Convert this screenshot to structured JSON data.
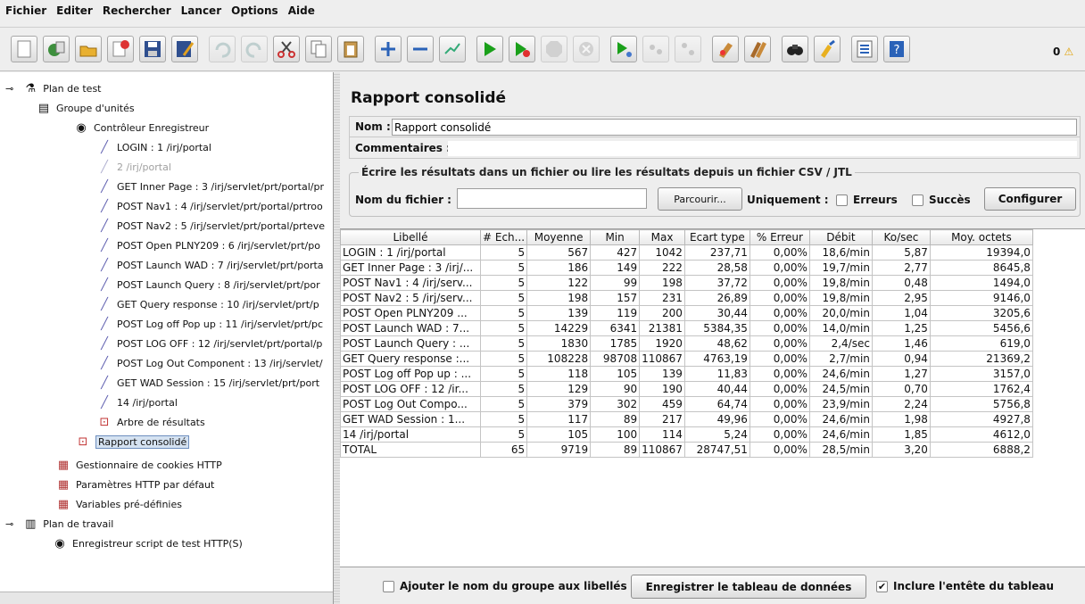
{
  "menu": {
    "items": [
      "Fichier",
      "Editer",
      "Rechercher",
      "Lancer",
      "Options",
      "Aide"
    ]
  },
  "toolbar": {
    "buttons": [
      "new-icon",
      "templates-icon",
      "open-icon",
      "close-icon",
      "save-icon",
      "save-as-icon",
      "undo-icon",
      "redo-icon",
      "cut-icon",
      "copy-icon",
      "paste-icon",
      "expand-icon",
      "collapse-icon",
      "toggle-icon",
      "start-icon",
      "start-no-pause-icon",
      "stop-icon",
      "shutdown-icon",
      "remote-start-icon",
      "remote-stop-icon",
      "remote-shutdown-icon",
      "clear-icon",
      "clear-all-icon",
      "search-icon",
      "reset-search-icon",
      "function-helper-icon",
      "help-icon"
    ],
    "error_count": "0"
  },
  "tree": {
    "nodes": [
      {
        "label": "Plan de test",
        "icon": "beaker-icon"
      },
      {
        "label": "Groupe d'unités",
        "icon": "thread-group-icon"
      },
      {
        "label": "Contrôleur Enregistreur",
        "icon": "controller-icon"
      },
      {
        "label": "LOGIN : 1 /irj/portal",
        "icon": "sampler-icon"
      },
      {
        "label": "2 /irj/portal",
        "icon": "sampler-icon"
      },
      {
        "label": "GET Inner Page : 3 /irj/servlet/prt/portal/pr",
        "icon": "sampler-icon"
      },
      {
        "label": "POST Nav1 : 4 /irj/servlet/prt/portal/prtroo",
        "icon": "sampler-icon"
      },
      {
        "label": "POST Nav2 : 5 /irj/servlet/prt/portal/prteve",
        "icon": "sampler-icon"
      },
      {
        "label": "POST Open PLNY209 : 6 /irj/servlet/prt/po",
        "icon": "sampler-icon"
      },
      {
        "label": "POST Launch WAD : 7 /irj/servlet/prt/porta",
        "icon": "sampler-icon"
      },
      {
        "label": "POST Launch Query : 8 /irj/servlet/prt/por",
        "icon": "sampler-icon"
      },
      {
        "label": "GET Query response : 10 /irj/servlet/prt/p",
        "icon": "sampler-icon"
      },
      {
        "label": "POST Log off Pop up : 11 /irj/servlet/prt/pc",
        "icon": "sampler-icon"
      },
      {
        "label": "POST LOG OFF : 12 /irj/servlet/prt/portal/p",
        "icon": "sampler-icon"
      },
      {
        "label": "POST Log Out Component : 13 /irj/servlet/",
        "icon": "sampler-icon"
      },
      {
        "label": "GET WAD Session : 15 /irj/servlet/prt/port",
        "icon": "sampler-icon"
      },
      {
        "label": "14 /irj/portal",
        "icon": "sampler-icon"
      },
      {
        "label": "Arbre de résultats",
        "icon": "listener-icon"
      },
      {
        "label": "Rapport consolidé",
        "icon": "listener-icon"
      },
      {
        "label": "Gestionnaire de cookies HTTP",
        "icon": "config-icon"
      },
      {
        "label": "Paramètres HTTP par défaut",
        "icon": "config-icon"
      },
      {
        "label": "Variables pré-définies",
        "icon": "config-icon"
      },
      {
        "label": "Plan de travail",
        "icon": "workbench-icon"
      },
      {
        "label": "Enregistreur script de test HTTP(S)",
        "icon": "proxy-icon"
      }
    ]
  },
  "report": {
    "title": "Rapport consolidé",
    "name_label": "Nom :",
    "name_value": "Rapport consolidé",
    "comments_label": "Commentaires :",
    "file_legend": "Écrire les résultats dans un fichier ou lire les résultats depuis un fichier CSV / JTL",
    "filename_label": "Nom du fichier :",
    "browse_label": "Parcourir...",
    "only_label": "Uniquement :",
    "errors_label": "Erreurs",
    "success_label": "Succès",
    "configure_label": "Configurer"
  },
  "table": {
    "headers": [
      "Libellé",
      "# Ech...",
      "Moyenne",
      "Min",
      "Max",
      "Ecart type",
      "% Erreur",
      "Débit",
      "Ko/sec",
      "Moy. octets"
    ],
    "rows": [
      [
        "LOGIN : 1 /irj/portal",
        "5",
        "567",
        "427",
        "1042",
        "237,71",
        "0,00%",
        "18,6/min",
        "5,87",
        "19394,0"
      ],
      [
        "GET Inner Page : 3 /irj/...",
        "5",
        "186",
        "149",
        "222",
        "28,58",
        "0,00%",
        "19,7/min",
        "2,77",
        "8645,8"
      ],
      [
        "POST Nav1 : 4 /irj/serv...",
        "5",
        "122",
        "99",
        "198",
        "37,72",
        "0,00%",
        "19,8/min",
        "0,48",
        "1494,0"
      ],
      [
        "POST Nav2 : 5 /irj/serv...",
        "5",
        "198",
        "157",
        "231",
        "26,89",
        "0,00%",
        "19,8/min",
        "2,95",
        "9146,0"
      ],
      [
        "POST Open PLNY209 ...",
        "5",
        "139",
        "119",
        "200",
        "30,44",
        "0,00%",
        "20,0/min",
        "1,04",
        "3205,6"
      ],
      [
        "POST Launch WAD : 7...",
        "5",
        "14229",
        "6341",
        "21381",
        "5384,35",
        "0,00%",
        "14,0/min",
        "1,25",
        "5456,6"
      ],
      [
        "POST Launch Query : ...",
        "5",
        "1830",
        "1785",
        "1920",
        "48,62",
        "0,00%",
        "2,4/sec",
        "1,46",
        "619,0"
      ],
      [
        "GET Query response :...",
        "5",
        "108228",
        "98708",
        "110867",
        "4763,19",
        "0,00%",
        "2,7/min",
        "0,94",
        "21369,2"
      ],
      [
        "POST Log off Pop up : ...",
        "5",
        "118",
        "105",
        "139",
        "11,83",
        "0,00%",
        "24,6/min",
        "1,27",
        "3157,0"
      ],
      [
        "POST LOG OFF : 12 /ir...",
        "5",
        "129",
        "90",
        "190",
        "40,44",
        "0,00%",
        "24,5/min",
        "0,70",
        "1762,4"
      ],
      [
        "POST Log Out Compo...",
        "5",
        "379",
        "302",
        "459",
        "64,74",
        "0,00%",
        "23,9/min",
        "2,24",
        "5756,8"
      ],
      [
        "GET WAD Session : 1...",
        "5",
        "117",
        "89",
        "217",
        "49,96",
        "0,00%",
        "24,6/min",
        "1,98",
        "4927,8"
      ],
      [
        "14 /irj/portal",
        "5",
        "105",
        "100",
        "114",
        "5,24",
        "0,00%",
        "24,6/min",
        "1,85",
        "4612,0"
      ],
      [
        "TOTAL",
        "65",
        "9719",
        "89",
        "110867",
        "28747,51",
        "0,00%",
        "28,5/min",
        "3,20",
        "6888,2"
      ]
    ]
  },
  "footer": {
    "add_group_label": "Ajouter le nom du groupe aux libellés",
    "save_table_label": "Enregistrer le tableau de données",
    "include_header_label": "Inclure l'entête du tableau",
    "include_header_checked": true,
    "add_group_checked": false
  }
}
